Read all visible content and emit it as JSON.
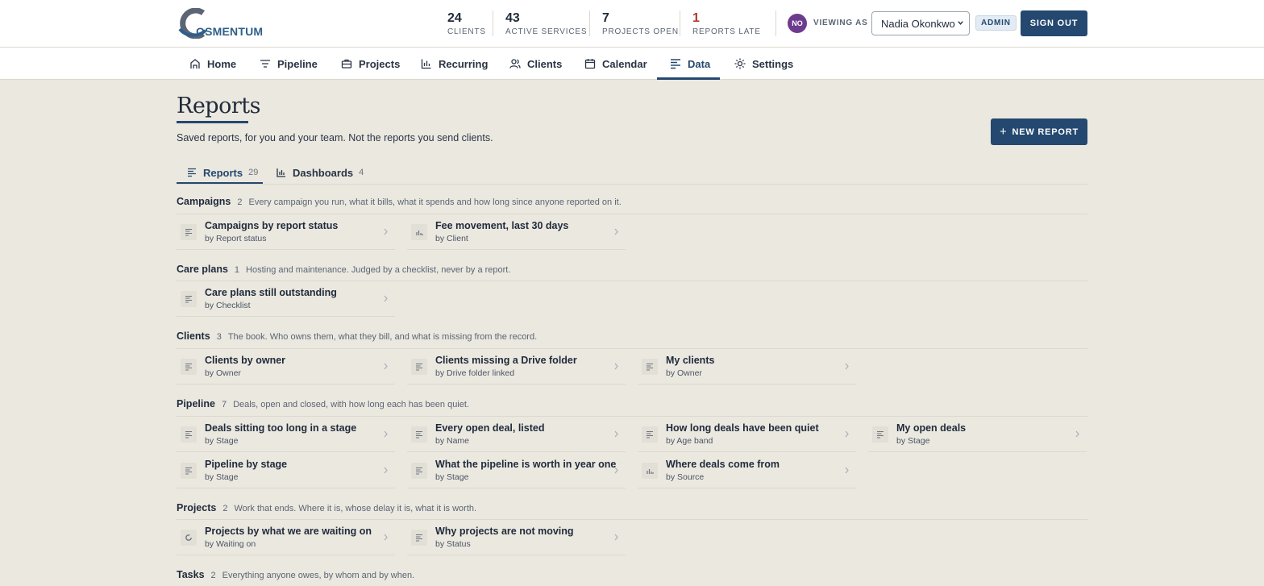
{
  "brand": {
    "name": "OSMENTUM",
    "mark": "C"
  },
  "stats": [
    {
      "value": "24",
      "label": "CLIENTS"
    },
    {
      "value": "43",
      "label": "ACTIVE SERVICES"
    },
    {
      "value": "7",
      "label": "PROJECTS OPEN"
    },
    {
      "value": "1",
      "label": "REPORTS LATE"
    }
  ],
  "user": {
    "initials": "NO",
    "viewing_as_label": "VIEWING AS",
    "selected": "Nadia Okonkwo",
    "role_badge": "ADMIN",
    "sign_out_label": "SIGN OUT"
  },
  "nav": {
    "items": [
      {
        "label": "Home",
        "icon": "home-icon"
      },
      {
        "label": "Pipeline",
        "icon": "filter-icon"
      },
      {
        "label": "Projects",
        "icon": "briefcase-icon"
      },
      {
        "label": "Recurring",
        "icon": "bar-chart-icon"
      },
      {
        "label": "Clients",
        "icon": "users-icon"
      },
      {
        "label": "Calendar",
        "icon": "calendar-icon"
      },
      {
        "label": "Data",
        "icon": "lines-icon",
        "active": true
      },
      {
        "label": "Settings",
        "icon": "sun-icon"
      }
    ]
  },
  "page": {
    "title": "Reports",
    "subtitle": "Saved reports, for you and your team. Not the reports you send clients.",
    "new_report_label": "NEW REPORT"
  },
  "tabs": [
    {
      "label": "Reports",
      "count": "29",
      "active": true,
      "icon": "lines-icon"
    },
    {
      "label": "Dashboards",
      "count": "4",
      "active": false,
      "icon": "bar-chart-icon"
    }
  ],
  "sections": [
    {
      "title": "Campaigns",
      "count": "2",
      "description": "Every campaign you run, what it bills, what it spends and how long since anyone reported on it.",
      "reports": [
        {
          "name": "Campaigns by report status",
          "by": "by Report status",
          "icon": "lines-icon"
        },
        {
          "name": "Fee movement, last 30 days",
          "by": "by Client",
          "icon": "bar-chart-icon"
        }
      ]
    },
    {
      "title": "Care plans",
      "count": "1",
      "description": "Hosting and maintenance. Judged by a checklist, never by a report.",
      "reports": [
        {
          "name": "Care plans still outstanding",
          "by": "by Checklist",
          "icon": "lines-icon"
        }
      ]
    },
    {
      "title": "Clients",
      "count": "3",
      "description": "The book. Who owns them, what they bill, and what is missing from the record.",
      "reports": [
        {
          "name": "Clients by owner",
          "by": "by Owner",
          "icon": "lines-icon"
        },
        {
          "name": "Clients missing a Drive folder",
          "by": "by Drive folder linked",
          "icon": "lines-icon"
        },
        {
          "name": "My clients",
          "by": "by Owner",
          "icon": "lines-icon"
        }
      ]
    },
    {
      "title": "Pipeline",
      "count": "7",
      "description": "Deals, open and closed, with how long each has been quiet.",
      "reports": [
        {
          "name": "Deals sitting too long in a stage",
          "by": "by Stage",
          "icon": "lines-icon"
        },
        {
          "name": "Every open deal, listed",
          "by": "by Name",
          "icon": "lines-icon"
        },
        {
          "name": "How long deals have been quiet",
          "by": "by Age band",
          "icon": "lines-icon"
        },
        {
          "name": "My open deals",
          "by": "by Stage",
          "icon": "lines-icon"
        },
        {
          "name": "Pipeline by stage",
          "by": "by Stage",
          "icon": "lines-icon"
        },
        {
          "name": "What the pipeline is worth in year one",
          "by": "by Stage",
          "icon": "lines-icon"
        },
        {
          "name": "Where deals come from",
          "by": "by Source",
          "icon": "bar-chart-icon"
        }
      ]
    },
    {
      "title": "Projects",
      "count": "2",
      "description": "Work that ends. Where it is, whose delay it is, what it is worth.",
      "reports": [
        {
          "name": "Projects by what we are waiting on",
          "by": "by Waiting on",
          "icon": "donut-icon"
        },
        {
          "name": "Why projects are not moving",
          "by": "by Status",
          "icon": "lines-icon"
        }
      ]
    },
    {
      "title": "Tasks",
      "count": "2",
      "description": "Everything anyone owes, by whom and by when.",
      "reports": []
    }
  ]
}
